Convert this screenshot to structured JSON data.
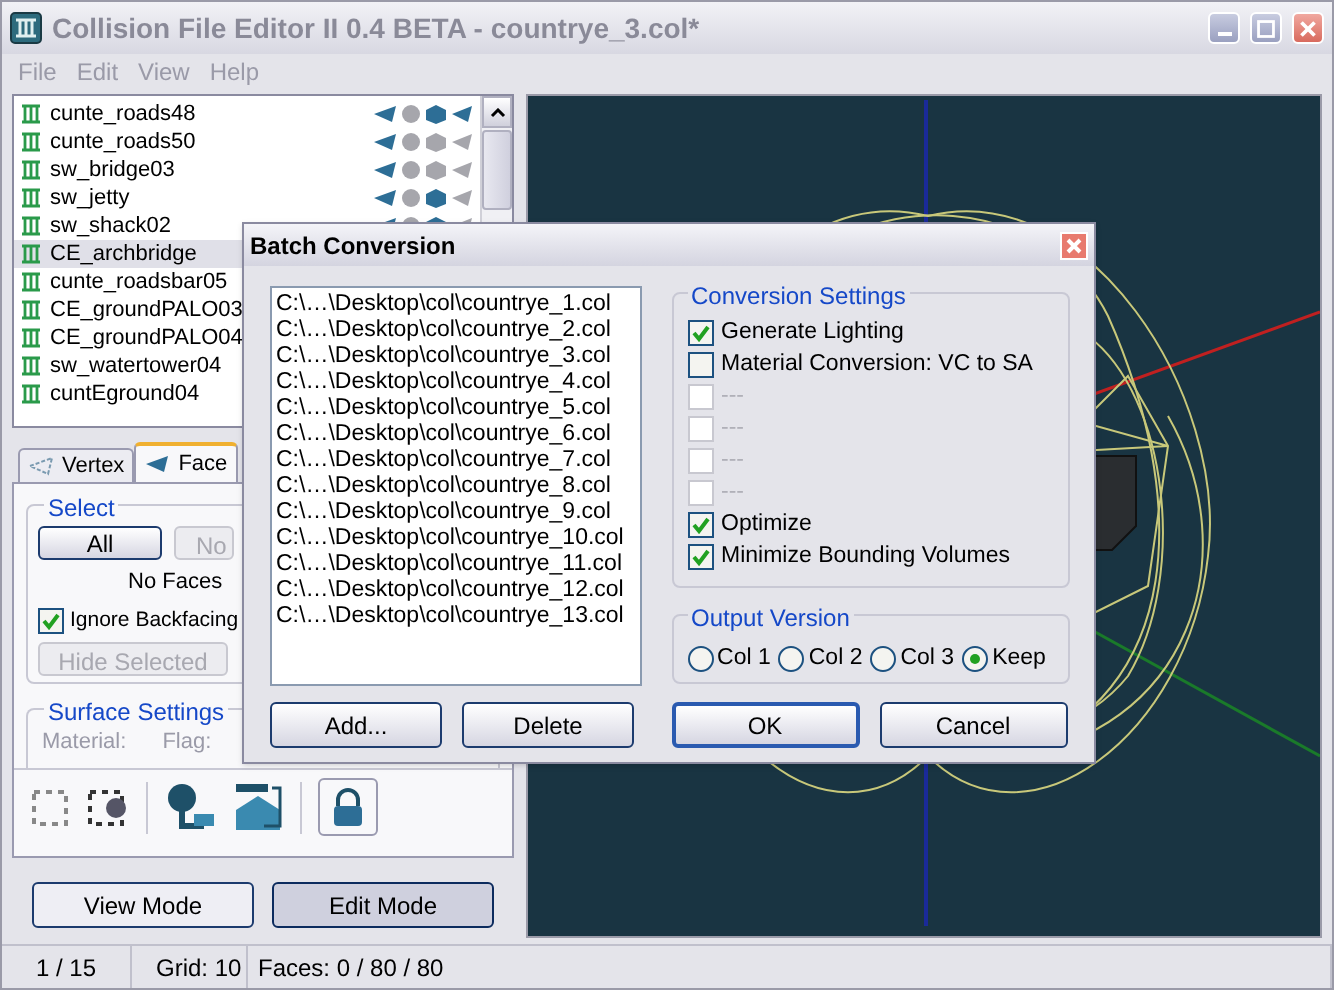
{
  "window": {
    "title": "Collision File Editor II 0.4 BETA - countrye_3.col*"
  },
  "menu": [
    "File",
    "Edit",
    "View",
    "Help"
  ],
  "model_list": {
    "items": [
      {
        "name": "cunte_roads48",
        "selected": false,
        "shapes": {
          "faces": true,
          "spheres": false,
          "boxes": true,
          "mesh": true
        }
      },
      {
        "name": "cunte_roads50",
        "selected": false,
        "shapes": {
          "faces": true,
          "spheres": false,
          "boxes": false,
          "mesh": false
        }
      },
      {
        "name": "sw_bridge03",
        "selected": false,
        "shapes": {
          "faces": true,
          "spheres": false,
          "boxes": false,
          "mesh": false
        }
      },
      {
        "name": "sw_jetty",
        "selected": false,
        "shapes": {
          "faces": true,
          "spheres": false,
          "boxes": true,
          "mesh": false
        }
      },
      {
        "name": "sw_shack02",
        "selected": false,
        "shapes": {
          "faces": true,
          "spheres": false,
          "boxes": true,
          "mesh": false
        }
      },
      {
        "name": "CE_archbridge",
        "selected": true
      },
      {
        "name": "cunte_roadsbar05",
        "selected": false
      },
      {
        "name": "CE_groundPALO03",
        "selected": false
      },
      {
        "name": "CE_groundPALO04",
        "selected": false
      },
      {
        "name": "sw_watertower04",
        "selected": false
      },
      {
        "name": "cuntEground04",
        "selected": false
      }
    ]
  },
  "tabs": [
    {
      "label": "Vertex",
      "selected": false
    },
    {
      "label": "Face",
      "selected": true
    }
  ],
  "select_group": {
    "title": "Select",
    "all_button": "All",
    "none_button": "No",
    "info": "No Faces",
    "ignore_backfacing": {
      "label": "Ignore Backfacing",
      "checked": true
    },
    "hide_button": {
      "label": "Hide Selected",
      "disabled": true
    }
  },
  "surface_group": {
    "title": "Surface Settings",
    "material_label": "Material:",
    "flag_label": "Flag:"
  },
  "mode_buttons": [
    {
      "label": "View Mode",
      "selected": false
    },
    {
      "label": "Edit Mode",
      "selected": true
    }
  ],
  "status_bar": [
    "1 / 15",
    "Grid: 10",
    "Faces: 0 / 80 / 80"
  ],
  "dialog": {
    "title": "Batch Conversion",
    "files": [
      "C:\\…\\Desktop\\col\\countrye_1.col",
      "C:\\…\\Desktop\\col\\countrye_2.col",
      "C:\\…\\Desktop\\col\\countrye_3.col",
      "C:\\…\\Desktop\\col\\countrye_4.col",
      "C:\\…\\Desktop\\col\\countrye_5.col",
      "C:\\…\\Desktop\\col\\countrye_6.col",
      "C:\\…\\Desktop\\col\\countrye_7.col",
      "C:\\…\\Desktop\\col\\countrye_8.col",
      "C:\\…\\Desktop\\col\\countrye_9.col",
      "C:\\…\\Desktop\\col\\countrye_10.col",
      "C:\\…\\Desktop\\col\\countrye_11.col",
      "C:\\…\\Desktop\\col\\countrye_12.col",
      "C:\\…\\Desktop\\col\\countrye_13.col"
    ],
    "settings": {
      "title": "Conversion Settings",
      "options": [
        {
          "label": "Generate Lighting",
          "checked": true,
          "disabled": false
        },
        {
          "label": "Material Conversion: VC to SA",
          "checked": false,
          "disabled": false
        },
        {
          "label": "---",
          "checked": false,
          "disabled": true
        },
        {
          "label": "---",
          "checked": false,
          "disabled": true
        },
        {
          "label": "---",
          "checked": false,
          "disabled": true
        },
        {
          "label": "---",
          "checked": false,
          "disabled": true
        },
        {
          "label": "Optimize",
          "checked": true,
          "disabled": false
        },
        {
          "label": "Minimize Bounding Volumes",
          "checked": true,
          "disabled": false
        }
      ]
    },
    "output": {
      "title": "Output Version",
      "options": [
        {
          "label": "Col 1",
          "selected": false
        },
        {
          "label": "Col 2",
          "selected": false
        },
        {
          "label": "Col 3",
          "selected": false
        },
        {
          "label": "Keep",
          "selected": true
        }
      ]
    },
    "list_buttons": [
      "Add...",
      "Delete"
    ],
    "buttons": [
      {
        "label": "OK",
        "default": true
      },
      {
        "label": "Cancel",
        "default": false
      }
    ]
  }
}
